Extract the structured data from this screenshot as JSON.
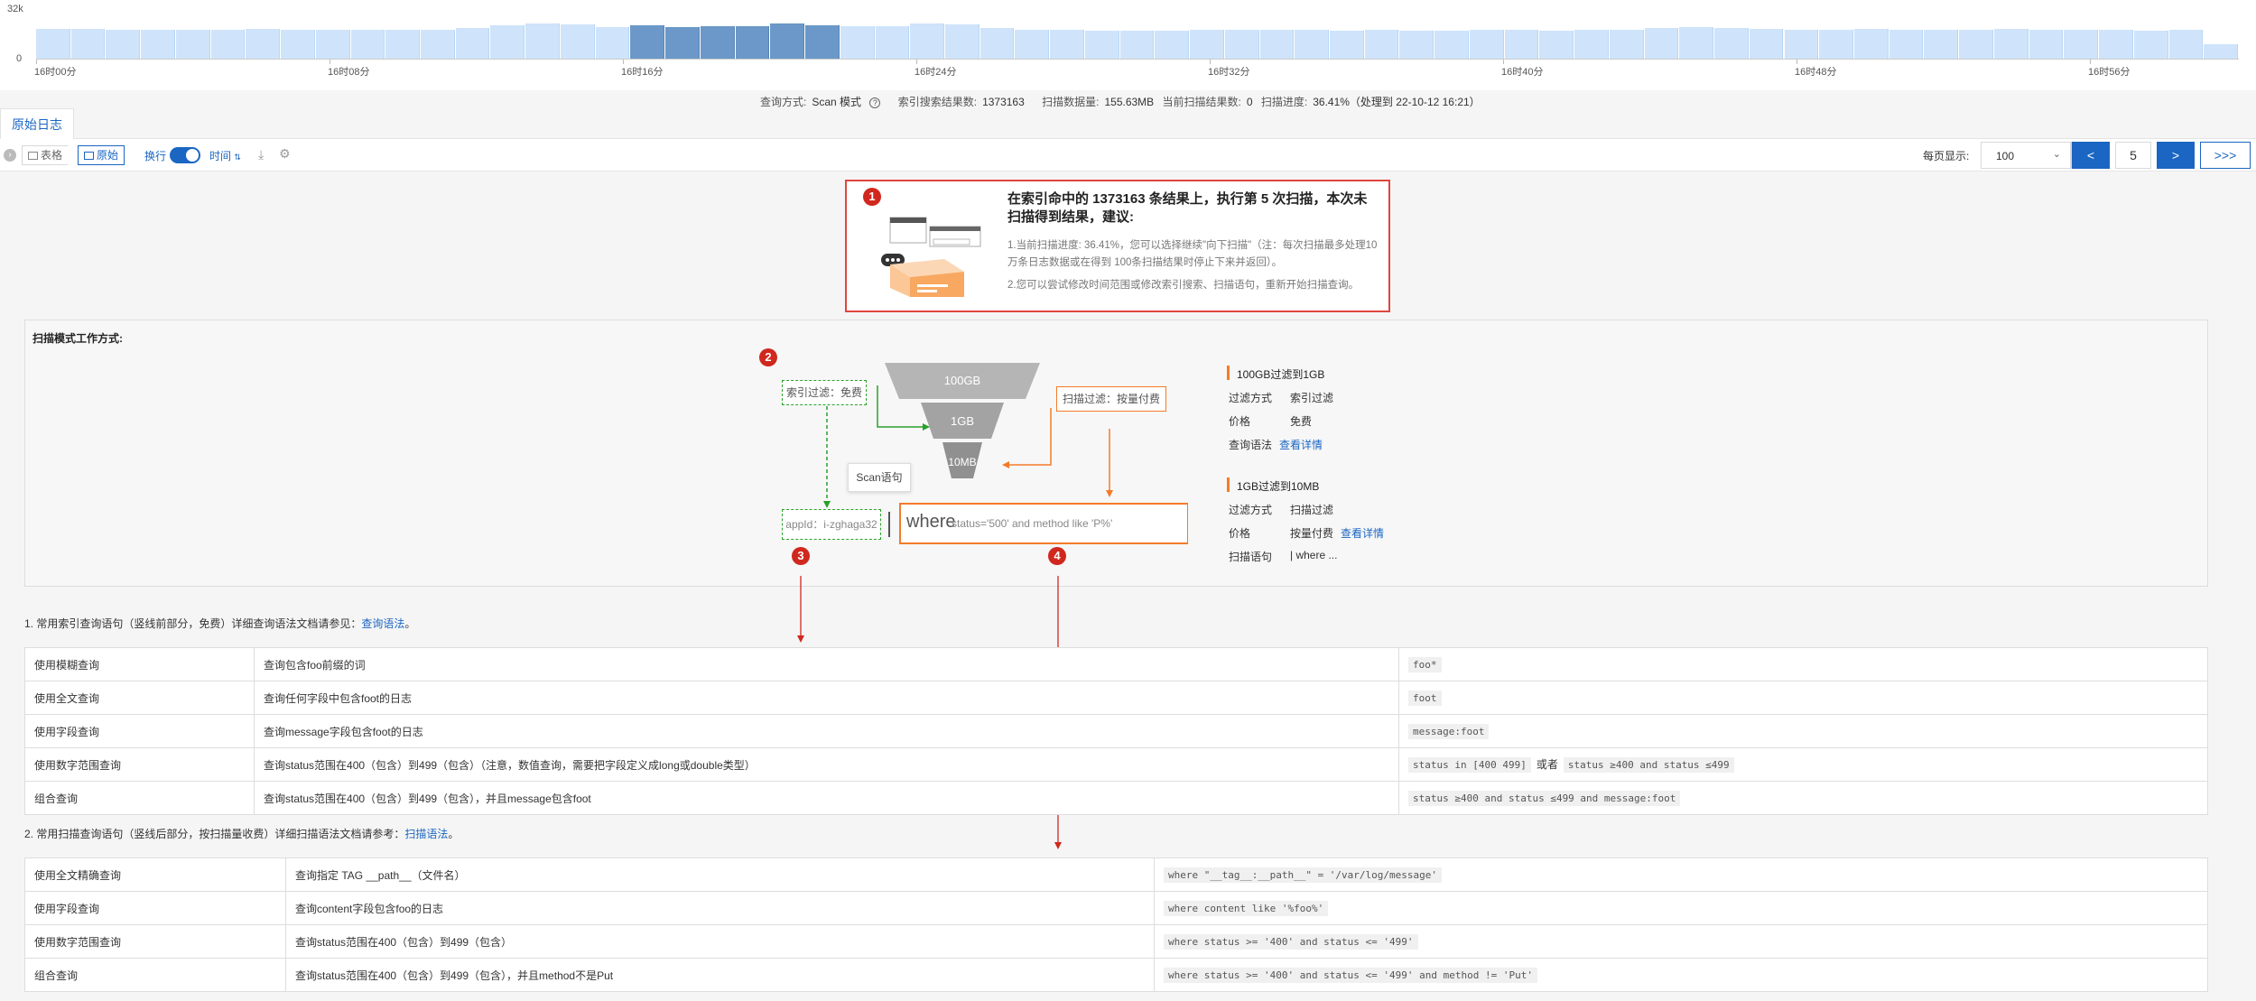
{
  "histogram": {
    "y_max_label": "32k",
    "y_min_label": "0",
    "values": [
      0.69,
      0.68,
      0.67,
      0.66,
      0.66,
      0.66,
      0.68,
      0.67,
      0.67,
      0.66,
      0.66,
      0.66,
      0.7,
      0.77,
      0.82,
      0.8,
      0.73,
      0.77,
      0.73,
      0.75,
      0.76,
      0.81,
      0.78,
      0.74,
      0.76,
      0.82,
      0.8,
      0.7,
      0.67,
      0.66,
      0.65,
      0.64,
      0.65,
      0.67,
      0.66,
      0.66,
      0.66,
      0.64,
      0.66,
      0.64,
      0.64,
      0.66,
      0.67,
      0.65,
      0.66,
      0.66,
      0.7,
      0.72,
      0.7,
      0.69,
      0.66,
      0.66,
      0.69,
      0.66,
      0.66,
      0.66,
      0.68,
      0.66,
      0.66,
      0.66,
      0.64,
      0.66,
      0.33
    ],
    "selected_start": 17,
    "selected_end": 22,
    "time_labels": [
      "16时00分",
      "16时08分",
      "16时16分",
      "16时24分",
      "16时32分",
      "16时40分",
      "16时48分",
      "16时56分"
    ]
  },
  "status": {
    "mode_label": "查询方式:",
    "mode_value": "Scan 模式",
    "help_icon": "?",
    "index_count_label": "索引搜索结果数:",
    "index_count": "1373163",
    "scan_size_label": "扫描数据量:",
    "scan_size": "155.63MB",
    "scan_result_label": "当前扫描结果数:",
    "scan_result": "0",
    "progress_label": "扫描进度:",
    "progress": "36.41%（处理到 22-10-12 16:21）"
  },
  "tab": {
    "label": "原始日志"
  },
  "toolbar": {
    "table_label": "表格",
    "raw_label": "原始",
    "wrap_label": "换行",
    "time_label": "时间",
    "per_page_label": "每页显示:",
    "per_page_value": "100",
    "prev": "<",
    "page": "5",
    "next": ">",
    "skip": ">>>"
  },
  "notice": {
    "badge": "1",
    "title": "在索引命中的 1373163 条结果上，执行第 5 次扫描，本次未扫描得到结果，建议:",
    "line1": "1.当前扫描进度: 36.41%，您可以选择继续\"向下扫描\"（注：每次扫描最多处理10万条日志数据或在得到 100条扫描结果时停止下来并返回）。",
    "line2": "2.您可以尝试修改时间范围或修改索引搜索、扫描语句，重新开始扫描查询。"
  },
  "scan": {
    "title": "扫描模式工作方式:",
    "badge2": "2",
    "badge3": "3",
    "badge4": "4",
    "index_filter": "索引过滤：免费",
    "scan_filter": "扫描过滤：按量付费",
    "funnel1": "100GB",
    "funnel2": "1GB",
    "funnel3": "10MB",
    "scan_tooltip": "Scan语句",
    "appid": "appId：i-zghaga32",
    "where_big": "where",
    "where_rest": "status='500' and method like 'P%'",
    "info1": {
      "heading": "100GB过滤到1GB",
      "method_label": "过滤方式",
      "method_value": "索引过滤",
      "price_label": "价格",
      "price_value": "免费",
      "syntax_label": "查询语法",
      "syntax_link": "查看详情"
    },
    "info2": {
      "heading": "1GB过滤到10MB",
      "method_label": "过滤方式",
      "method_value": "扫描过滤",
      "price_label": "价格",
      "price_value": "按量付费",
      "price_link": "查看详情",
      "syntax_label": "扫描语句",
      "syntax_value": "| where ..."
    }
  },
  "section1": {
    "text": "1. 常用索引查询语句（竖线前部分，免费）详细查询语法文档请参见：",
    "link": "查询语法",
    "end": "。",
    "rows": [
      {
        "name": "使用模糊查询",
        "desc": "查询包含foo前缀的词",
        "code": [
          "foo*"
        ]
      },
      {
        "name": "使用全文查询",
        "desc": "查询任何字段中包含foot的日志",
        "code": [
          "foot"
        ]
      },
      {
        "name": "使用字段查询",
        "desc": "查询message字段包含foot的日志",
        "code": [
          "message:foot"
        ]
      },
      {
        "name": "使用数字范围查询",
        "desc": "查询status范围在400（包含）到499（包含）（注意，数值查询，需要把字段定义成long或double类型）",
        "code": [
          "status in [400 499]",
          "或者",
          "status ≥400 and status ≤499"
        ]
      },
      {
        "name": "组合查询",
        "desc": "查询status范围在400（包含）到499（包含），并且message包含foot",
        "code": [
          "status ≥400 and status ≤499 and message:foot"
        ]
      }
    ]
  },
  "section2": {
    "text": "2. 常用扫描查询语句（竖线后部分，按扫描量收费）详细扫描语法文档请参考：",
    "link": "扫描语法",
    "end": "。",
    "rows": [
      {
        "name": "使用全文精确查询",
        "desc": "查询指定 TAG __path__（文件名）",
        "code": [
          "where \"__tag__:__path__\" = '/var/log/message'"
        ]
      },
      {
        "name": "使用字段查询",
        "desc": "查询content字段包含foo的日志",
        "code": [
          "where content like '%foo%'"
        ]
      },
      {
        "name": "使用数字范围查询",
        "desc": "查询status范围在400（包含）到499（包含）",
        "code": [
          "where status >= '400' and status <= '499'"
        ]
      },
      {
        "name": "组合查询",
        "desc": "查询status范围在400（包含）到499（包含），并且method不是Put",
        "code": [
          "where status >= '400' and status <= '499' and method != 'Put'"
        ]
      }
    ]
  }
}
